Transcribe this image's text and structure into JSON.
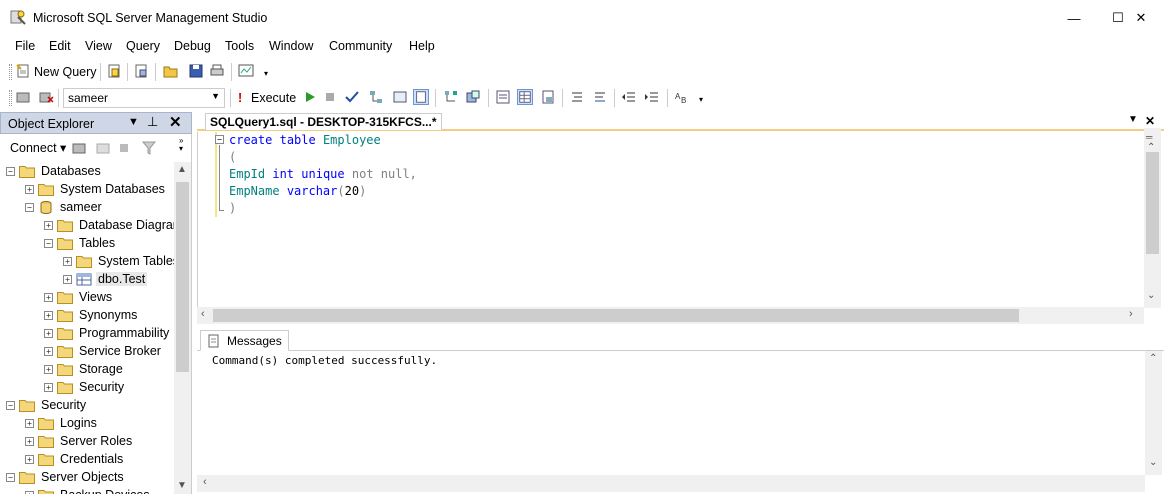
{
  "window": {
    "title": "Microsoft SQL Server Management Studio",
    "minimize": "—",
    "maximize": "☐",
    "close": "✕"
  },
  "menu": [
    "File",
    "Edit",
    "View",
    "Query",
    "Debug",
    "Tools",
    "Window",
    "Community",
    "Help"
  ],
  "toolbar1": {
    "new_query": "New Query"
  },
  "toolbar2": {
    "database": "sameer",
    "execute": "Execute"
  },
  "object_explorer": {
    "title": "Object Explorer",
    "connect": "Connect",
    "tree": [
      {
        "label": "Databases",
        "expander": "−"
      },
      {
        "label": "System Databases",
        "expander": "+"
      },
      {
        "label": "sameer",
        "expander": "−"
      },
      {
        "label": "Database Diagrams",
        "expander": "+"
      },
      {
        "label": "Tables",
        "expander": "−"
      },
      {
        "label": "System Tables",
        "expander": "+"
      },
      {
        "label": "dbo.Test",
        "expander": "+"
      },
      {
        "label": "Views",
        "expander": "+"
      },
      {
        "label": "Synonyms",
        "expander": "+"
      },
      {
        "label": "Programmability",
        "expander": "+"
      },
      {
        "label": "Service Broker",
        "expander": "+"
      },
      {
        "label": "Storage",
        "expander": "+"
      },
      {
        "label": "Security",
        "expander": "+"
      },
      {
        "label": "Security",
        "expander": "−"
      },
      {
        "label": "Logins",
        "expander": "+"
      },
      {
        "label": "Server Roles",
        "expander": "+"
      },
      {
        "label": "Credentials",
        "expander": "+"
      },
      {
        "label": "Server Objects",
        "expander": "−"
      },
      {
        "label": "Backup Devices",
        "expander": "+"
      }
    ]
  },
  "editor": {
    "tab_title": "SQLQuery1.sql - DESKTOP-315KFCS...*",
    "code": {
      "l1_kw1": "create",
      "l1_kw2": "table",
      "l1_id": "Employee",
      "l2": "(",
      "l3_id": "EmpId",
      "l3_kw1": "int",
      "l3_kw2": "unique",
      "l3_rest": "not null,",
      "l4_id": "EmpName",
      "l4_kw": "varchar",
      "l4_paren_open": "(",
      "l4_num": "20",
      "l4_paren_close": ")",
      "l5": ")"
    }
  },
  "results": {
    "tab": "Messages",
    "message": "Command(s) completed successfully."
  },
  "colors": {
    "keyword": "#0000ff",
    "identifier": "#008080",
    "gray": "#808080",
    "accent_tab": "#f5cc84"
  }
}
